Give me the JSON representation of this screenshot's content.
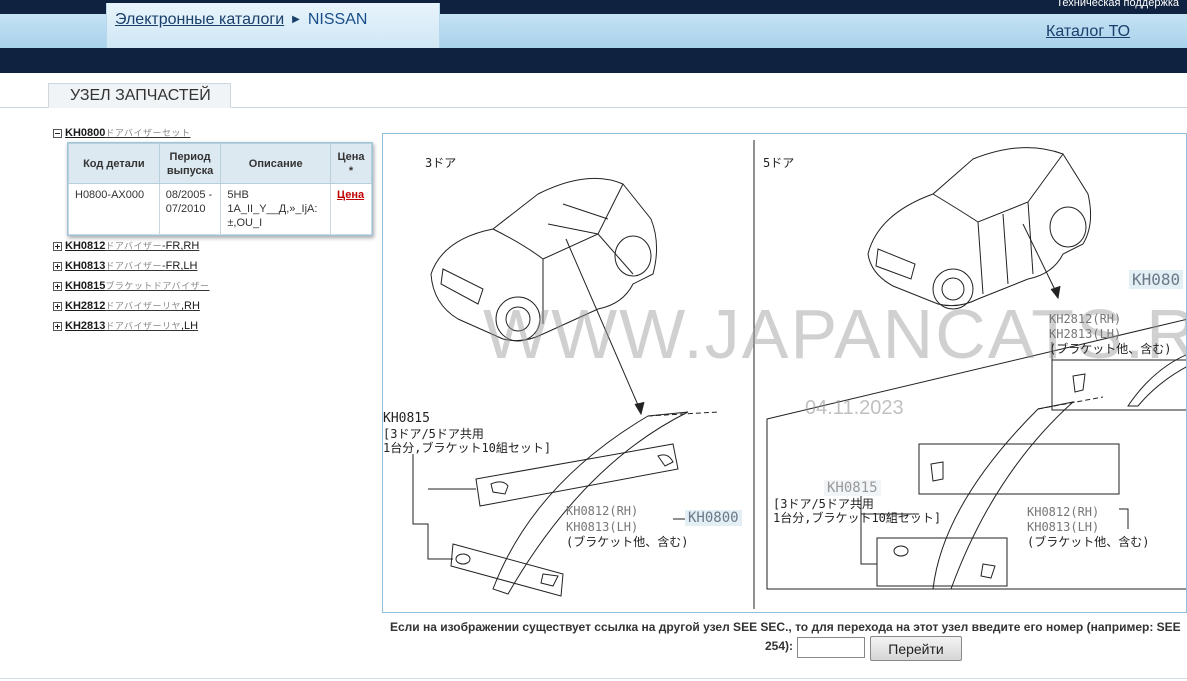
{
  "header": {
    "support_text": "Техническая поддержка",
    "breadcrumb": {
      "root": "Электронные каталоги",
      "current": "NISSAN"
    },
    "catalog_link": "Каталог ТО"
  },
  "tabs": [
    {
      "label": "УЗЕЛ ЗАПЧАСТЕЙ"
    }
  ],
  "tree": [
    {
      "code": "KH0800",
      "desc_jp": "ドアバイザーセット",
      "suffix": "",
      "expanded": true
    },
    {
      "code": "KH0812",
      "desc_jp": "ドアバイザー",
      "suffix": "FR,RH",
      "expanded": false
    },
    {
      "code": "KH0813",
      "desc_jp": "ドアバイザー",
      "suffix": "FR,LH",
      "expanded": false
    },
    {
      "code": "KH0815",
      "desc_jp": "ブラケットドアバイザー",
      "suffix": "",
      "expanded": false
    },
    {
      "code": "KH2812",
      "desc_jp": "ドアバイザーリヤ",
      "suffix": ",RH",
      "expanded": false
    },
    {
      "code": "KH2813",
      "desc_jp": "ドアバイザーリヤ",
      "suffix": ",LH",
      "expanded": false
    }
  ],
  "parts_table": {
    "headers": [
      "Код детали",
      "Период выпуска",
      "Описание",
      "Цена *"
    ],
    "rows": [
      {
        "part_no": "H0800-AX000",
        "period": "08/2005 - 07/2010",
        "description": "5HB 1A_II_Y__Д,»_IjA: ±,OU_I",
        "price_link": "Цена"
      }
    ]
  },
  "diagram": {
    "watermark": "WWW.JAPANCATS.RU",
    "date": "04.11.2023",
    "left_panel": {
      "title": "3ドア",
      "bracket_code": "KH0815",
      "bracket_note_1": "[3ドア/5ドア共用",
      "bracket_note_2": "1台分,ブラケット10組セット]",
      "visor_code_rh": "KH0812(RH)",
      "visor_code_lh": "KH0813(LH)",
      "visor_note": "(ブラケット他、含む)",
      "set_code": "KH0800"
    },
    "right_panel": {
      "title": "5ドア",
      "corner_code": "KH080",
      "rear_code_rh": "KH2812(RH)",
      "rear_code_lh": "KH2813(LH)",
      "rear_note": "(ブラケット他、含む)",
      "bracket_code": "KH0815",
      "bracket_note_1": "[3ドア/5ドア共用",
      "bracket_note_2": "1台分,ブラケット10組セット]",
      "front_code_rh": "KH0812(RH)",
      "front_code_lh": "KH0813(LH)",
      "front_note": "(ブラケット他、含む)"
    }
  },
  "footer": {
    "note": "Если на изображении существует ссылка на другой узел SEE SEC., то для перехода на этот узел введите его номер (например: SEE",
    "note_tail": "254):",
    "input_value": "",
    "button_label": "Перейти"
  }
}
